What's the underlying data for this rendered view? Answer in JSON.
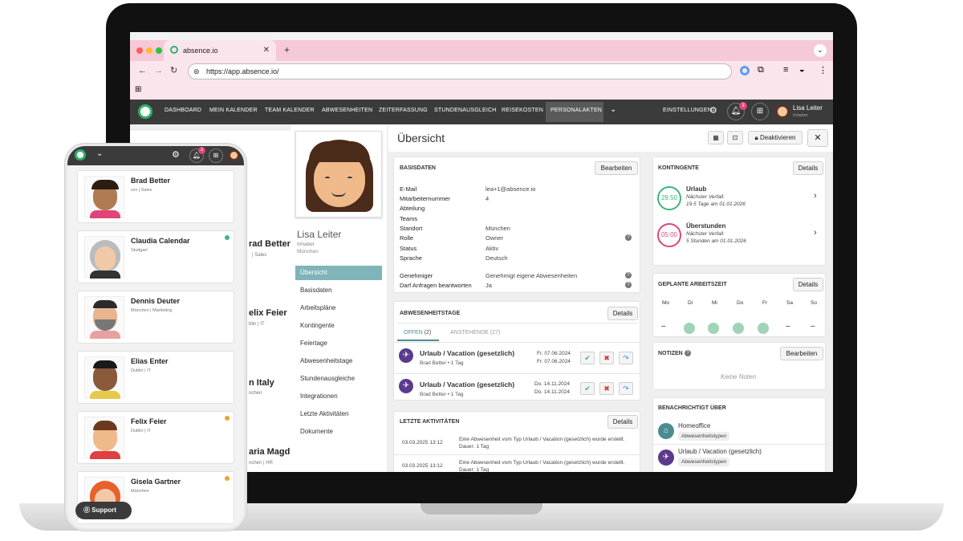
{
  "browser": {
    "tab_title": "absence.io",
    "url": "https://app.absence.io/"
  },
  "nav": {
    "items": [
      "DASHBOARD",
      "MEIN KALENDER",
      "TEAM KALENDER",
      "ABWESENHEITEN",
      "ZEITERFASSUNG",
      "STUNDENAUSGLEICH",
      "REISEKOSTEN",
      "PERSONALAKTEN"
    ],
    "settings": "EINSTELLUNGEN",
    "badge": "3",
    "user_name": "Lisa Leiter",
    "user_role": "Inhaber"
  },
  "profile": {
    "name": "Lisa Leiter",
    "role": "Inhaber",
    "city": "München"
  },
  "sidebar": [
    "Übersicht",
    "Basisdaten",
    "Arbeitspläne",
    "Kontingente",
    "Feiertage",
    "Abwesenheitstage",
    "Stundenausgleiche",
    "Integrationen",
    "Letzte Aktivitäten",
    "Dokumente"
  ],
  "page": {
    "title": "Übersicht",
    "deactivate": "Deaktivieren"
  },
  "basisdaten": {
    "title": "BASISDATEN",
    "button": "Bearbeiten",
    "rows": [
      [
        "E-Mail",
        "lea+1@absence.io"
      ],
      [
        "Mitarbeiternummer",
        "4"
      ],
      [
        "Abteilung",
        ""
      ],
      [
        "Teams",
        ""
      ],
      [
        "Standort",
        "München"
      ],
      [
        "Rolle",
        "Owner"
      ],
      [
        "Status",
        "Aktiv"
      ],
      [
        "Sprache",
        "Deutsch"
      ]
    ],
    "rows2": [
      [
        "Genehmiger",
        "Genehmigt eigene Abwesenheiten"
      ],
      [
        "Darf Anfragen beantworten",
        "Ja"
      ]
    ]
  },
  "abwesenheitstage": {
    "title": "ABWESENHEITSTAGE",
    "button": "Details",
    "tab_open": "OFFEN",
    "tab_open_count": "(2)",
    "tab_pending": "ANSTEHENDE",
    "tab_pending_count": "(27)",
    "items": [
      {
        "title": "Urlaub / Vacation (gesetzlich)",
        "sub": "Brad Better • 1 Tag",
        "from": "Fr. 07.06.2024",
        "to": "Fr. 07.06.2024"
      },
      {
        "title": "Urlaub / Vacation (gesetzlich)",
        "sub": "Brad Better • 1 Tag",
        "from": "Do. 14.11.2024",
        "to": "Do. 14.11.2024"
      }
    ]
  },
  "aktivitaeten": {
    "title": "LETZTE AKTIVITÄTEN",
    "button": "Details",
    "items": [
      {
        "date": "03.03.2025 13:12",
        "text": "Eine Abwesenheit vom Typ Urlaub / Vacation (gesetzlich) wurde erstellt. Dauer: 1 Tag"
      },
      {
        "date": "03.03.2025 13:12",
        "text": "Eine Abwesenheit vom Typ Urlaub / Vacation (gesetzlich) wurde erstellt. Dauer: 1 Tag"
      }
    ]
  },
  "kontingente": {
    "title": "KONTINGENTE",
    "button": "Details",
    "items": [
      {
        "value": "29.50",
        "name": "Urlaub",
        "l1": "Nächster Verfall:",
        "l2": "19.5 Tage am 01.01.2026",
        "color": "#3fb57a"
      },
      {
        "value": "05:00",
        "name": "Überstunden",
        "l1": "Nächster Verfall:",
        "l2": "5 Stunden am 01.01.2026",
        "color": "#e0457a"
      }
    ]
  },
  "arbeitszeit": {
    "title": "GEPLANTE ARBEITSZEIT",
    "button": "Details",
    "days": [
      "Mo",
      "Di",
      "Mi",
      "Do",
      "Fr",
      "Sa",
      "So"
    ],
    "values": [
      "–",
      "",
      "",
      "",
      "",
      "–",
      "–"
    ]
  },
  "notizen": {
    "title": "NOTIZEN",
    "button": "Bearbeiten",
    "empty": "Keine Noten"
  },
  "benachrichtigt": {
    "title": "BENACHRICHTIGT ÜBER",
    "items": [
      {
        "name": "Homeoffice",
        "chip": "Abwesenheitstypen"
      },
      {
        "name": "Urlaub / Vacation (gesetzlich)",
        "chip": "Abwesenheitstypen"
      }
    ]
  },
  "phone": {
    "badge": "3",
    "support": "Support",
    "people": [
      {
        "name": "Brad Better",
        "sub": "xxx | Sales",
        "dot": ""
      },
      {
        "name": "Claudia Calendar",
        "sub": "Stuttgart",
        "dot": "#3fb57a"
      },
      {
        "name": "Dennis Deuter",
        "sub": "München | Marketing",
        "dot": ""
      },
      {
        "name": "Elias Enter",
        "sub": "Dublin | IT",
        "dot": ""
      },
      {
        "name": "Felix Feier",
        "sub": "Dublin | IT",
        "dot": "#f0a030"
      },
      {
        "name": "Gisela Gartner",
        "sub": "München",
        "dot": "#f0a030"
      }
    ]
  },
  "behind_list": [
    {
      "name": "rad Better",
      "sub": "| Sales"
    },
    {
      "name": "elix Feier",
      "sub": "blin | IT"
    },
    {
      "name": "n Italy",
      "sub": "nchen"
    },
    {
      "name": "aria Magd",
      "sub": "nchen | HR"
    }
  ]
}
